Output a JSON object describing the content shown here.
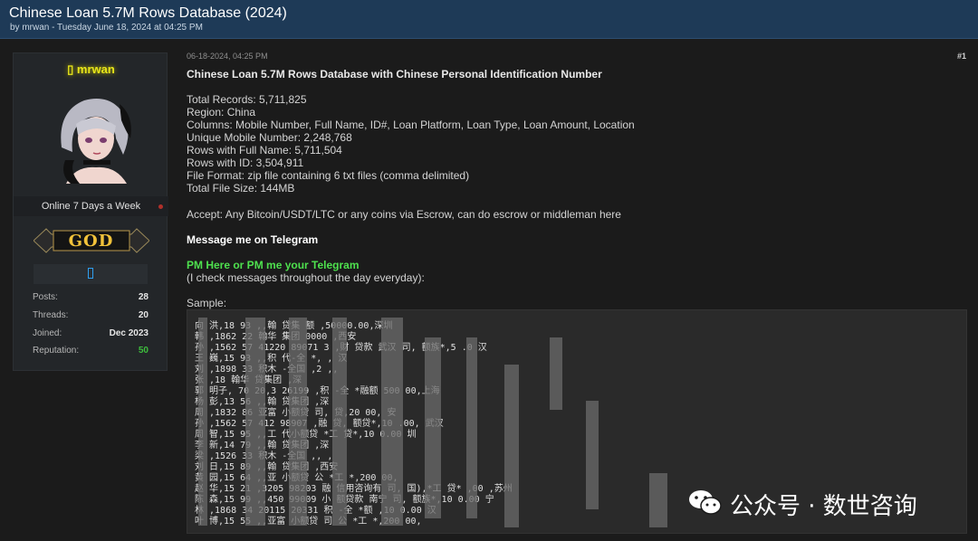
{
  "header": {
    "title": "Chinese Loan 5.7M Rows Database (2024)",
    "byline": "by mrwan - Tuesday June 18, 2024 at 04:25 PM"
  },
  "user": {
    "name": "mrwan",
    "status": "Online 7 Days a Week",
    "rank": "GOD",
    "stats": [
      {
        "key": "Posts:",
        "value": "28"
      },
      {
        "key": "Threads:",
        "value": "20"
      },
      {
        "key": "Joined:",
        "value": "Dec 2023"
      },
      {
        "key": "Reputation:",
        "value": "50"
      }
    ]
  },
  "post": {
    "date": "06-18-2024, 04:25 PM",
    "number": "#1",
    "heading": "Chinese Loan 5.7M Rows Database with Chinese Personal Identification Number",
    "details": [
      "Total Records: 5,711,825",
      "Region: China",
      "Columns: Mobile Number, Full Name, ID#, Loan Platform, Loan Type, Loan Amount, Location",
      "Unique Mobile Number: 2,248,768",
      "Rows with Full Name: 5,711,504",
      "Rows with ID:  3,504,911",
      "File Format: zip file containing 6 txt files (comma delimited)",
      "Total File Size: 144MB"
    ],
    "accept": "Accept: Any Bitcoin/USDT/LTC or any coins via Escrow, can do escrow or middleman here",
    "telegram": "Message me on Telegram",
    "pm": "PM Here or PM me your Telegram",
    "pm_note": "(I check messages throughout the day everyday):",
    "sample_label": "Sample:"
  },
  "sample_lines": [
    "向  洪,18    93   ,,翰    贷集     额    ,50000.00,深圳",
    "韩  ,1862    22    翰华    集团     0000  ,西安",
    "孙  ,1562   57   41220    89071   3    ,财    贷款     武汉      司,    额族*,5    .0     汉",
    "王  巍,15    93   ,,积    代-全         *,    ,    汉",
    "刘  ,1898    33   积木    -全国     ,2        ,,",
    "张  ,18        翰华    贷集团           ,深",
    "郭  明子,      70   20,3    26199        ,积      -全    *融额     500     00,上海",
    "杨  彭,13    56   ,,翰    贷集团          ,深",
    "周  ,1832    86   亚富    小额贷      司,   贷,20     00,  安",
    "孙  ,1562   57   412      98907      ,融    贷,    额贷*,10     .00,   武汉",
    "周  智,15    95   ,,工    代小额贷         *工    贷*,10   0.00    圳",
    "李  新,14    79   ,,翰    贷集团         ,深",
    "梁  ,1526    33   积木    -全国      ,,   ,",
    "刘  日,15    89   ,,翰    贷集团           ,西安",
    "黄  园,15    64   ,,亚    小额贷       公  *工    *,200    00,",
    "赵  华,15    21   ,3205    98203       融    信用咨询有   司,   国),*工    贷*    ,00    ,苏州",
    "陈  森,15    99   ,,450    99009      小    额贷款    南宁    司,    额族*,10  0.00   宁",
    "林  ,1868    34   20115    20331      积      -全    *额    ,10  0.00    汉",
    "叶  博,15    55   ,,亚富    小额贷    司       公   *工    *,200    00,"
  ],
  "watermark": {
    "text": "公众号 · 数世咨询",
    "icon": "wechat-icon"
  }
}
